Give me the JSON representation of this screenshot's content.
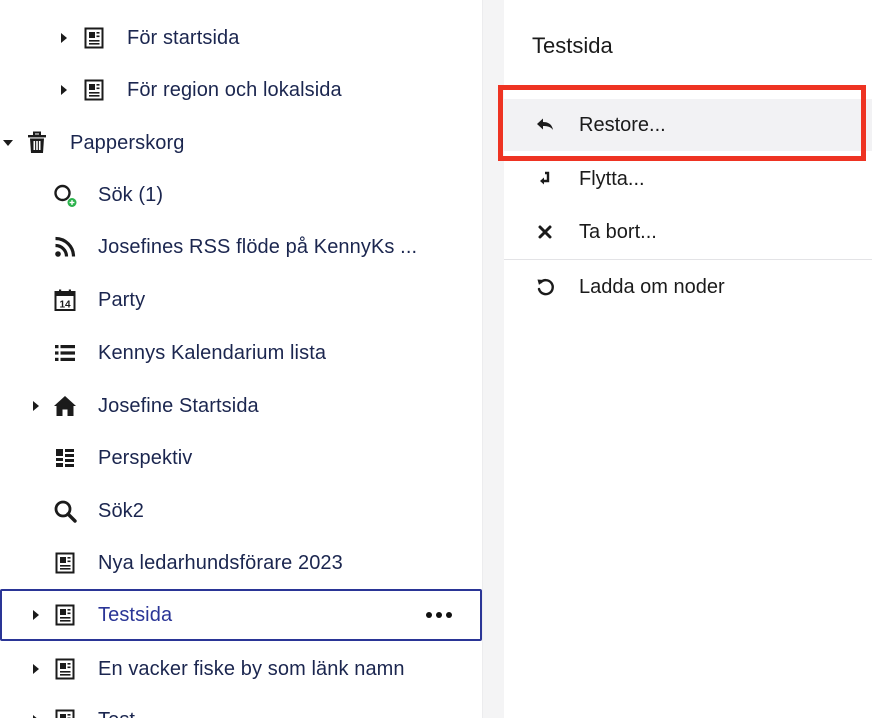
{
  "tree": {
    "items": [
      {
        "label": "För startsida",
        "icon": "document-icon",
        "expander": "collapsed"
      },
      {
        "label": "För region och lokalsida",
        "icon": "document-icon",
        "expander": "collapsed"
      },
      {
        "label": "Papperskorg",
        "icon": "trash-icon",
        "expander": "expanded"
      },
      {
        "label": "Sök (1)",
        "icon": "search-plus-icon",
        "expander": "none"
      },
      {
        "label": "Josefines RSS flöde på KennyKs ...",
        "icon": "rss-icon",
        "expander": "none"
      },
      {
        "label": "Party",
        "icon": "calendar-icon",
        "expander": "none",
        "calendar_day": "14"
      },
      {
        "label": "Kennys Kalendarium lista",
        "icon": "list-icon",
        "expander": "none"
      },
      {
        "label": "Josefine Startsida",
        "icon": "home-icon",
        "expander": "collapsed"
      },
      {
        "label": "Perspektiv",
        "icon": "grid-list-icon",
        "expander": "none"
      },
      {
        "label": "Sök2",
        "icon": "search-icon",
        "expander": "none"
      },
      {
        "label": "Nya ledarhundsförare 2023",
        "icon": "document-icon",
        "expander": "none"
      },
      {
        "label": "Testsida",
        "icon": "document-icon",
        "expander": "collapsed",
        "selected": true
      },
      {
        "label": "En vacker fiske by som länk namn",
        "icon": "document-icon",
        "expander": "collapsed"
      },
      {
        "label": "Test",
        "icon": "document-icon",
        "expander": "collapsed"
      }
    ],
    "more_actions_icon": "more-horizontal-icon"
  },
  "menu": {
    "title": "Testsida",
    "items": [
      {
        "label": "Restore...",
        "icon": "restore-icon",
        "highlighted": true
      },
      {
        "label": "Flytta...",
        "icon": "move-icon"
      },
      {
        "label": "Ta bort...",
        "icon": "close-icon"
      },
      {
        "label": "Ladda om noder",
        "icon": "reload-icon"
      }
    ]
  },
  "colors": {
    "text": "#1b264f",
    "selected_border": "#2a3596",
    "annotation_red": "#ee3322",
    "menu_hover": "#f2f2f4"
  }
}
